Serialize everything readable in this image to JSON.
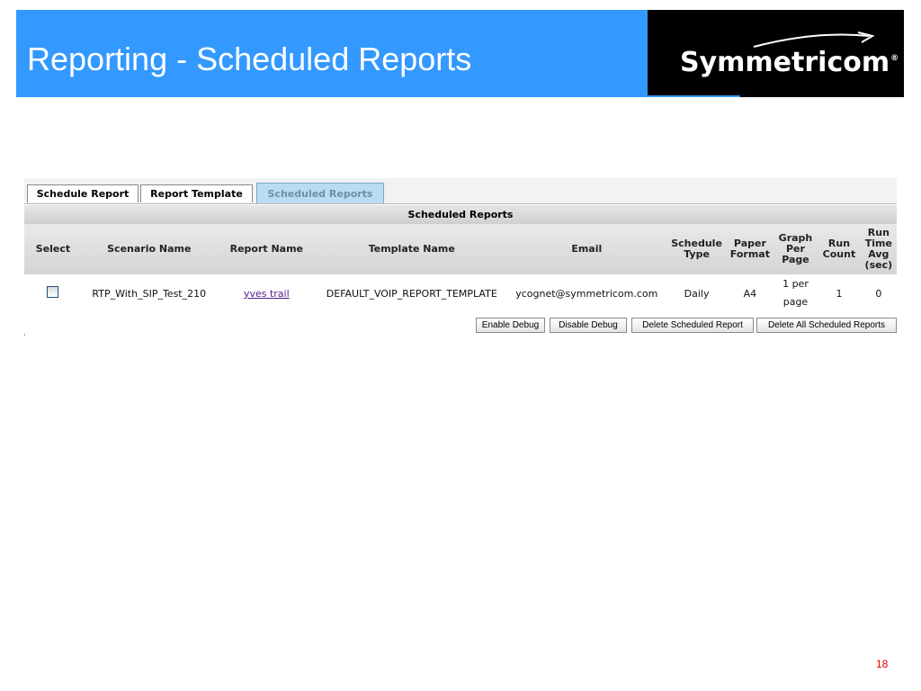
{
  "slide": {
    "title": "Reporting - Scheduled Reports",
    "page_number": "18",
    "brand": {
      "name": "Symmetricom",
      "reg": "®"
    },
    "colors": {
      "header": "#3399ff",
      "logo_bg": "#000000",
      "page_number": "#e60000"
    }
  },
  "tabs": [
    {
      "label": "Schedule Report",
      "active": false
    },
    {
      "label": "Report Template",
      "active": false
    },
    {
      "label": "Scheduled Reports",
      "active": true
    }
  ],
  "table": {
    "caption": "Scheduled Reports",
    "headers": {
      "select": "Select",
      "scenario": "Scenario Name",
      "report": "Report Name",
      "template": "Template Name",
      "email": "Email",
      "schedule": "Schedule Type",
      "paper": "Paper Format",
      "graph": "Graph Per Page",
      "run_count": "Run Count",
      "run_time": "Run Time Avg (sec)"
    },
    "rows": [
      {
        "checked": false,
        "scenario": "RTP_With_SIP_Test_210",
        "report": "yves trail",
        "template": "DEFAULT_VOIP_REPORT_TEMPLATE",
        "email": "ycognet@symmetricom.com",
        "schedule": "Daily",
        "paper": "A4",
        "graph": "1 per page",
        "run_count": "1",
        "run_time": "0"
      }
    ]
  },
  "buttons": {
    "enable_debug": "Enable Debug",
    "disable_debug": "Disable Debug",
    "delete_scheduled": "Delete Scheduled Report",
    "delete_all": "Delete All Scheduled Reports"
  }
}
